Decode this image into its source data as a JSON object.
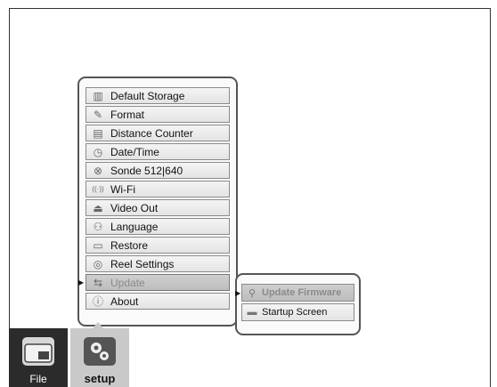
{
  "setup_menu": {
    "items": [
      {
        "label": "Default Storage",
        "icon": "storage-icon",
        "glyph": "▥"
      },
      {
        "label": "Format",
        "icon": "format-icon",
        "glyph": "✎"
      },
      {
        "label": "Distance Counter",
        "icon": "distance-counter-icon",
        "glyph": "▤"
      },
      {
        "label": "Date/Time",
        "icon": "clock-icon",
        "glyph": "◷"
      },
      {
        "label": "Sonde 512|640",
        "icon": "sonde-icon",
        "glyph": "⊗"
      },
      {
        "label": "Wi-Fi",
        "icon": "wifi-icon",
        "glyph": "((·))"
      },
      {
        "label": "Video Out",
        "icon": "video-out-icon",
        "glyph": "⏏"
      },
      {
        "label": "Language",
        "icon": "language-icon",
        "glyph": "⚇"
      },
      {
        "label": "Restore",
        "icon": "restore-icon",
        "glyph": "▭"
      },
      {
        "label": "Reel Settings",
        "icon": "reel-icon",
        "glyph": "◎"
      },
      {
        "label": "Update",
        "icon": "update-icon",
        "glyph": "⇆",
        "selected": true
      },
      {
        "label": "About",
        "icon": "info-icon",
        "glyph": "ⓘ"
      }
    ]
  },
  "update_submenu": {
    "items": [
      {
        "label": "Update Firmware",
        "icon": "firmware-icon",
        "glyph": "⚲",
        "selected": true
      },
      {
        "label": "Startup Screen",
        "icon": "startup-screen-icon",
        "glyph": "▬"
      }
    ]
  },
  "tabs": {
    "file_label": "File",
    "setup_label": "setup"
  }
}
